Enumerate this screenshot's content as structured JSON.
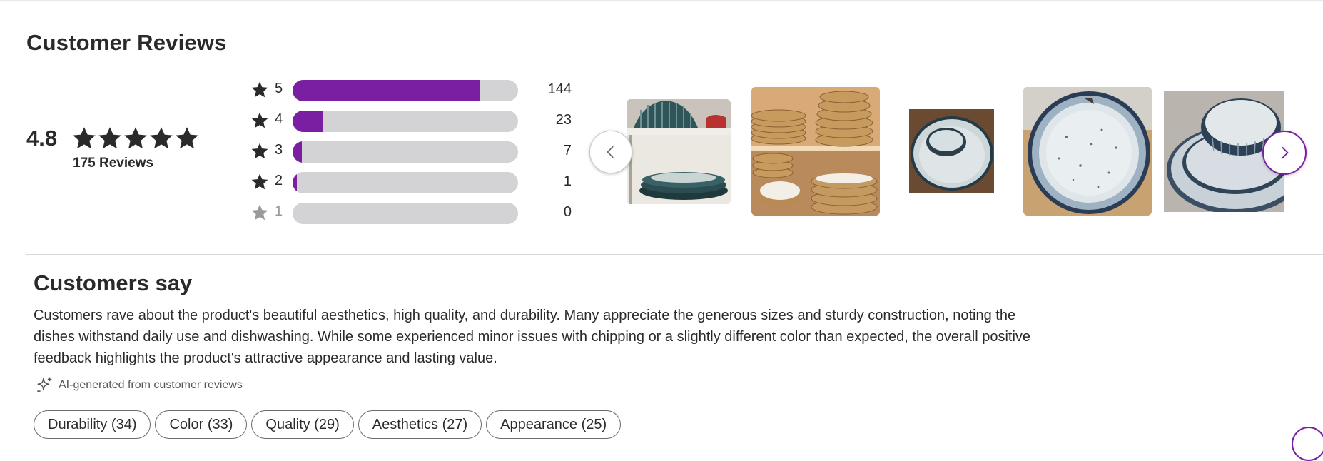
{
  "reviews": {
    "title": "Customer Reviews",
    "average": "4.8",
    "average_stars": 5,
    "count_label": "175 Reviews",
    "histogram": [
      {
        "level": "5",
        "count": "144",
        "fraction": 0.83
      },
      {
        "level": "4",
        "count": "23",
        "fraction": 0.135
      },
      {
        "level": "3",
        "count": "7",
        "fraction": 0.04
      },
      {
        "level": "2",
        "count": "1",
        "fraction": 0.006
      },
      {
        "level": "1",
        "count": "0",
        "fraction": 0.0
      }
    ],
    "colors": {
      "accent": "#7b1fa2",
      "track": "#d3d3d6",
      "star": "#2a2a2a",
      "star_dim": "#9a9a9a"
    }
  },
  "gallery": {
    "prev_icon": "chevron-left-icon",
    "next_icon": "chevron-right-icon",
    "photos": [
      "photo-shelf-teal-dishes",
      "photo-shelf-stacked-bowls",
      "photo-bowl-on-plate",
      "photo-speckled-plate",
      "photo-stacked-dinnerware"
    ]
  },
  "summary": {
    "title": "Customers say",
    "text": "Customers rave about the product's beautiful aesthetics, high quality, and durability. Many appreciate the generous sizes and sturdy construction, noting the dishes withstand daily use and dishwashing. While some experienced minor issues with chipping or a slightly different color than expected, the overall positive feedback highlights the product's attractive appearance and lasting value.",
    "ai_note": "AI-generated from customer reviews",
    "ai_icon": "sparkle-icon",
    "chips": [
      "Durability (34)",
      "Color (33)",
      "Quality (29)",
      "Aesthetics (27)",
      "Appearance (25)"
    ]
  }
}
